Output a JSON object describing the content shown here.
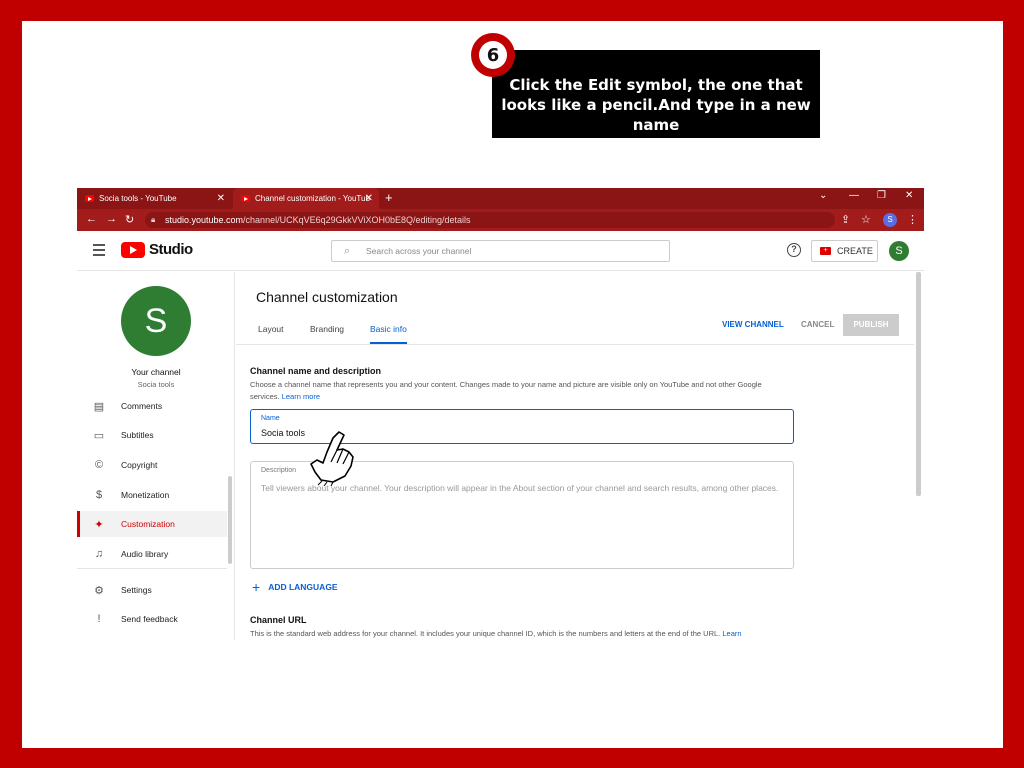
{
  "callout": {
    "step_number": "6",
    "text": "Click the Edit symbol, the one that looks like a pencil.And type in a new name"
  },
  "browser": {
    "tabs": [
      {
        "label": "Socia tools - YouTube"
      },
      {
        "label": "Channel customization - YouTub"
      }
    ],
    "new_tab": "+",
    "url_host": "studio.youtube.com",
    "url_path": "/channel/UCKqVE6q29GkkVViXOH0bE8Q/editing/details",
    "profile_initial": "S"
  },
  "header": {
    "logo_text": "Studio",
    "search_placeholder": "Search across your channel",
    "help": "?",
    "create_label": "CREATE",
    "account_initial": "S"
  },
  "sidebar": {
    "avatar_initial": "S",
    "your_channel": "Your channel",
    "channel_name": "Socia tools",
    "items": [
      {
        "label": "Comments",
        "icon": "comments-icon",
        "glyph": "▤"
      },
      {
        "label": "Subtitles",
        "icon": "subtitles-icon",
        "glyph": "▭"
      },
      {
        "label": "Copyright",
        "icon": "copyright-icon",
        "glyph": "©"
      },
      {
        "label": "Monetization",
        "icon": "dollar-icon",
        "glyph": "$"
      },
      {
        "label": "Customization",
        "icon": "magic-wand-icon",
        "glyph": "✦"
      },
      {
        "label": "Audio library",
        "icon": "audio-library-icon",
        "glyph": "♫"
      },
      {
        "label": "Settings",
        "icon": "gear-icon",
        "glyph": "⚙"
      },
      {
        "label": "Send feedback",
        "icon": "feedback-icon",
        "glyph": "!"
      }
    ],
    "active_item": "Customization"
  },
  "main": {
    "title": "Channel customization",
    "tabs": [
      {
        "label": "Layout"
      },
      {
        "label": "Branding"
      },
      {
        "label": "Basic info"
      }
    ],
    "active_tab": "Basic info",
    "view_channel": "VIEW CHANNEL",
    "cancel": "CANCEL",
    "publish": "PUBLISH",
    "name_section": {
      "title": "Channel name and description",
      "description": "Choose a channel name that represents you and your content. Changes made to your name and picture are visible only on YouTube and not other Google services.",
      "learn_more": "Learn more"
    },
    "name_field": {
      "label": "Name",
      "value": "Socia tools"
    },
    "description_field": {
      "label": "Description",
      "placeholder": "Tell viewers about your channel. Your description will appear in the About section of your channel and search results, among other places."
    },
    "add_language": "ADD LANGUAGE",
    "url_section": {
      "title": "Channel URL",
      "description": "This is the standard web address for your channel. It includes your unique channel ID, which is the numbers and letters at the end of the URL.",
      "learn": "Learn"
    }
  },
  "colors": {
    "frame": "#c00000",
    "accent_blue": "#065fd4",
    "avatar_green": "#2e7d32"
  }
}
